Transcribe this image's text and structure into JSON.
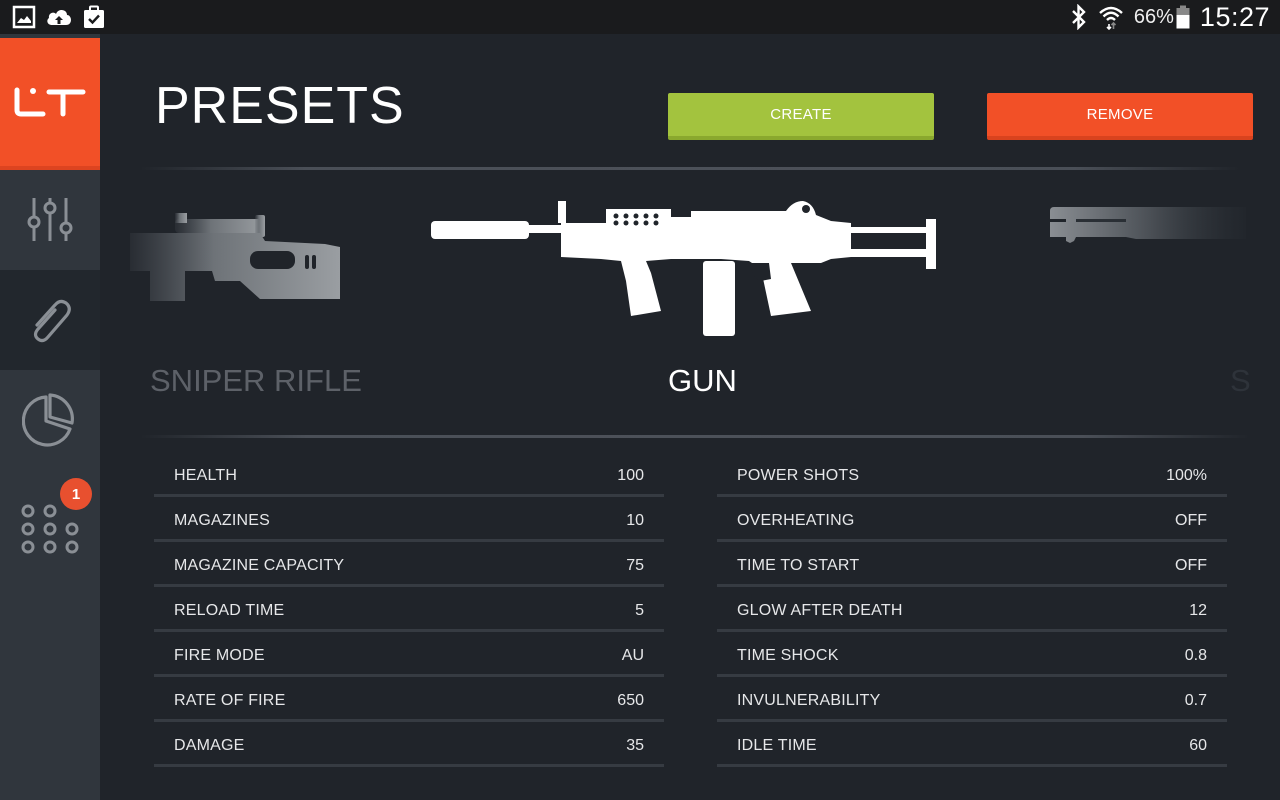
{
  "status_bar": {
    "left_icons": [
      "gallery-icon",
      "cloud-upload-icon",
      "clipboard-check-icon"
    ],
    "right_icons": [
      "bluetooth-icon",
      "wifi-icon",
      "battery-icon"
    ],
    "battery_percent": "66%",
    "battery_level": 0.66,
    "time": "15:27"
  },
  "sidebar": {
    "logo_text": "LT",
    "accent_color": "#f25027",
    "items": [
      {
        "name": "tuning",
        "icon": "sliders-icon",
        "active": false
      },
      {
        "name": "presets",
        "icon": "paperclip-icon",
        "active": true
      },
      {
        "name": "statistics",
        "icon": "pie-chart-icon",
        "active": false
      },
      {
        "name": "apps",
        "icon": "dots-grid-icon",
        "active": false,
        "badge": "1"
      }
    ]
  },
  "header": {
    "title": "PRESETS",
    "create_label": "CREATE",
    "remove_label": "REMOVE",
    "create_color": "#a3c33e",
    "remove_color": "#f25027"
  },
  "carousel": {
    "prev": {
      "label": "SNIPER RIFLE",
      "icon": "sniper-rifle-icon"
    },
    "current": {
      "label": "GUN",
      "icon": "machine-gun-icon"
    },
    "next": {
      "label": "S",
      "icon": "shotgun-icon"
    }
  },
  "stats_left": [
    {
      "label": "HEALTH",
      "value": "100"
    },
    {
      "label": "MAGAZINES",
      "value": "10"
    },
    {
      "label": "MAGAZINE CAPACITY",
      "value": "75"
    },
    {
      "label": "RELOAD TIME",
      "value": "5"
    },
    {
      "label": "FIRE MODE",
      "value": "AU"
    },
    {
      "label": "RATE OF FIRE",
      "value": "650"
    },
    {
      "label": "DAMAGE",
      "value": "35"
    }
  ],
  "stats_right": [
    {
      "label": "POWER SHOTS",
      "value": "100%"
    },
    {
      "label": "OVERHEATING",
      "value": "OFF"
    },
    {
      "label": "TIME TO START",
      "value": "OFF"
    },
    {
      "label": "GLOW AFTER DEATH",
      "value": "12"
    },
    {
      "label": "TIME SHOCK",
      "value": "0.8"
    },
    {
      "label": "INVULNERABILITY",
      "value": "0.7"
    },
    {
      "label": "IDLE TIME",
      "value": "60"
    }
  ]
}
